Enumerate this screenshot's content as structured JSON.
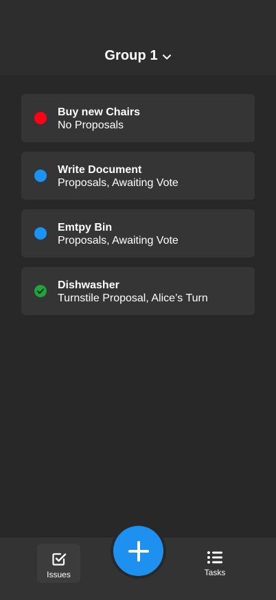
{
  "header": {
    "title": "Group 1",
    "chevron_icon": "chevron-down-icon"
  },
  "issues": [
    {
      "title": "Buy new Chairs",
      "status": "No Proposals",
      "dot_color": "#ff0015",
      "icon": "status-dot"
    },
    {
      "title": "Write Document",
      "status": "Proposals, Awaiting Vote",
      "dot_color": "#1a93f5",
      "icon": "status-dot"
    },
    {
      "title": "Emtpy Bin",
      "status": "Proposals, Awaiting Vote",
      "dot_color": "#1a93f5",
      "icon": "status-dot"
    },
    {
      "title": "Dishwasher",
      "status": "Turnstile Proposal, Alice’s Turn",
      "dot_color": "#20a43c",
      "icon": "check-circle-icon"
    }
  ],
  "nav": {
    "issues_label": "Issues",
    "tasks_label": "Tasks",
    "issues_icon": "checkbox-icon",
    "tasks_icon": "list-icon",
    "add_icon": "plus-icon"
  },
  "colors": {
    "background": "#282828",
    "card": "#353535",
    "accent": "#1e90f0"
  }
}
